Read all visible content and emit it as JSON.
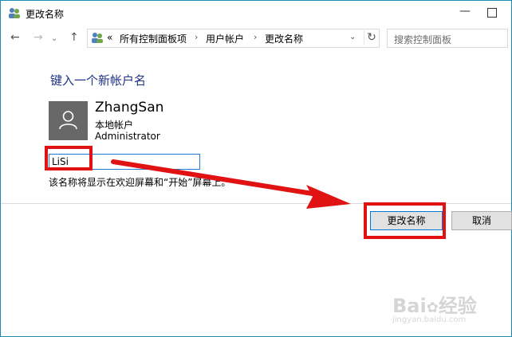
{
  "window": {
    "title": "更改名称",
    "min_glyph": "—",
    "icon": "users-control-panel-icon"
  },
  "nav": {
    "back_glyph": "←",
    "forward_glyph": "→",
    "dropdown_glyph": "⌄",
    "up_glyph": "↑",
    "address": {
      "overflow": "«",
      "crumbs": [
        "所有控制面板项",
        "用户帐户",
        "更改名称"
      ],
      "separator": "›",
      "dropdown_glyph": "⌄",
      "refresh_glyph": "↻"
    },
    "search_placeholder": "搜索控制面板"
  },
  "main": {
    "heading": "键入一个新帐户名",
    "user": {
      "name": "ZhangSan",
      "type": "本地帐户",
      "role": "Administrator"
    },
    "new_name_value": "LiSi",
    "hint": "该名称将显示在欢迎屏幕和“开始”屏幕上。"
  },
  "buttons": {
    "rename": "更改名称",
    "cancel": "取消"
  },
  "colors": {
    "heading": "#1e3287",
    "annotation": "#e01212",
    "accent_border": "#0078d7"
  },
  "watermark": {
    "brand": "Bai",
    "brand_suffix": "经验",
    "site": "jingyan.baidu.com"
  }
}
